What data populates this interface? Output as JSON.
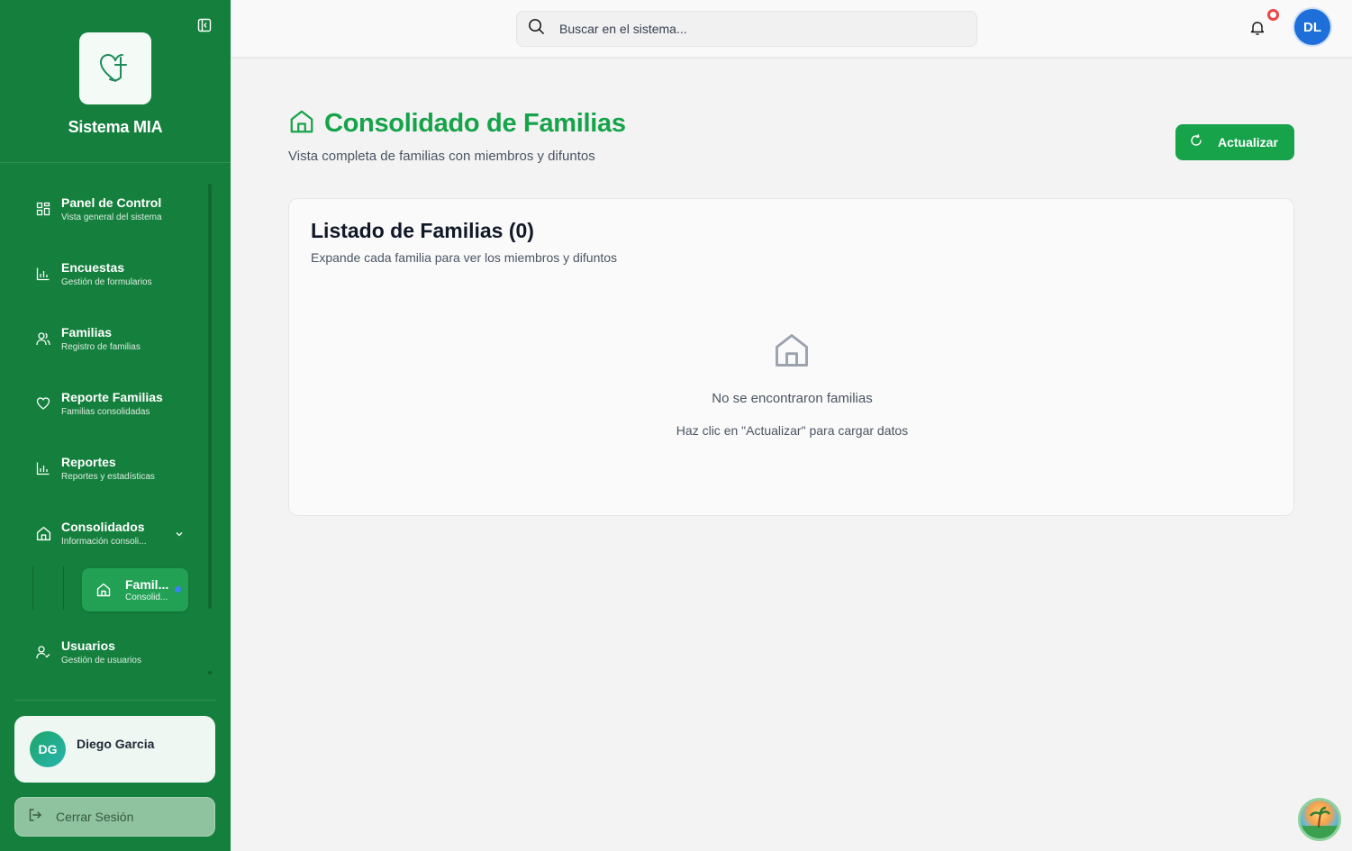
{
  "sidebar": {
    "app_name": "Sistema MIA",
    "items": [
      {
        "label": "Panel de Control",
        "sub": "Vista general del sistema",
        "icon": "dashboard-icon"
      },
      {
        "label": "Encuestas",
        "sub": "Gestión de formularios",
        "icon": "bar-chart-icon"
      },
      {
        "label": "Familias",
        "sub": "Registro de familias",
        "icon": "users-icon"
      },
      {
        "label": "Reporte Familias",
        "sub": "Familias consolidadas",
        "icon": "heart-icon"
      },
      {
        "label": "Reportes",
        "sub": "Reportes y estadísticas",
        "icon": "bar-chart-icon"
      },
      {
        "label": "Consolidados",
        "sub": "Información consoli...",
        "icon": "home-icon"
      },
      {
        "label": "Usuarios",
        "sub": "Gestión de usuarios",
        "icon": "user-check-icon"
      }
    ],
    "active_sub": {
      "label": "Famil...",
      "sub": "Consolid..."
    },
    "user": {
      "initials": "DG",
      "name": "Diego Garcia"
    },
    "logout_label": "Cerrar Sesión"
  },
  "topbar": {
    "search_placeholder": "Buscar en el sistema...",
    "avatar_initials": "DL"
  },
  "page": {
    "title": "Consolidado de Familias",
    "subtitle": "Vista completa de familias con miembros y difuntos",
    "refresh_label": "Actualizar"
  },
  "card": {
    "title": "Listado de Familias (0)",
    "subtitle": "Expande cada familia para ver los miembros y difuntos",
    "empty_title": "No se encontraron familias",
    "empty_hint": "Haz clic en \"Actualizar\" para cargar datos"
  },
  "colors": {
    "sidebar_bg": "#15803d",
    "accent": "#16a34a",
    "avatar_blue": "#1e6fd9",
    "notification": "#ef4444"
  }
}
